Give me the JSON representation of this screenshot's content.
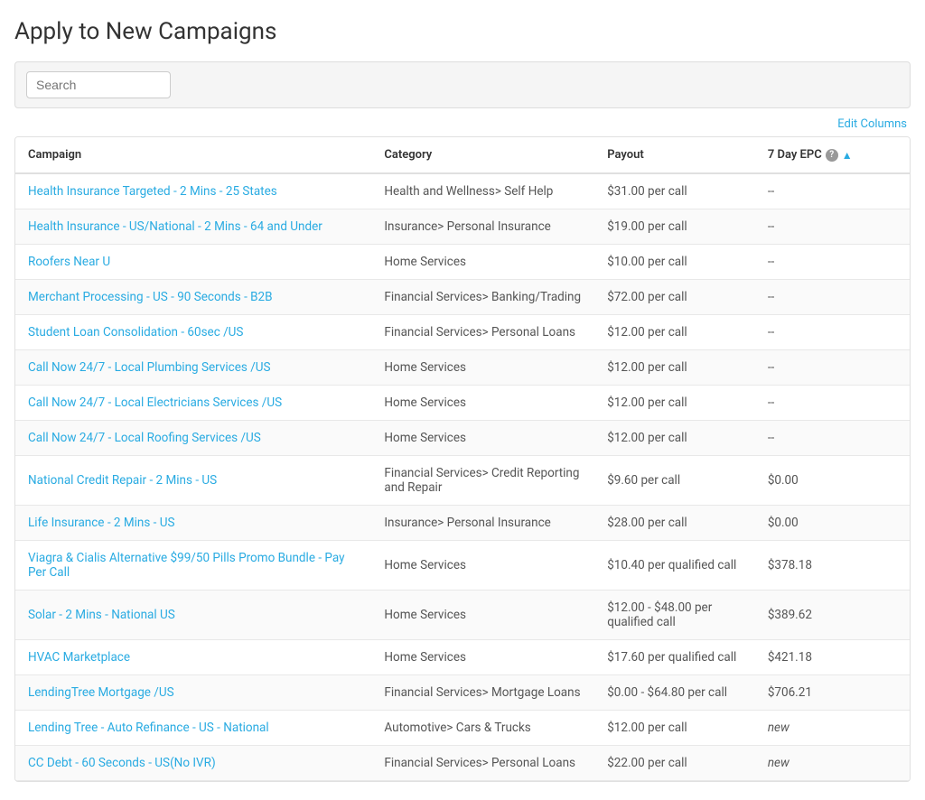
{
  "page": {
    "title": "Apply to New Campaigns"
  },
  "search": {
    "placeholder": "Search"
  },
  "edit_columns": {
    "label": "Edit Columns"
  },
  "table": {
    "headers": [
      {
        "id": "campaign",
        "label": "Campaign",
        "has_sort": false,
        "has_help": false
      },
      {
        "id": "category",
        "label": "Category",
        "has_sort": false,
        "has_help": false
      },
      {
        "id": "payout",
        "label": "Payout",
        "has_sort": false,
        "has_help": false
      },
      {
        "id": "7day",
        "label": "7 Day EPC",
        "has_sort": true,
        "has_help": true
      },
      {
        "id": "extra",
        "label": "",
        "has_sort": false,
        "has_help": false
      }
    ],
    "rows": [
      {
        "campaign": "Health Insurance Targeted - 2 Mins - 25 States",
        "category": "Health and Wellness> Self Help",
        "payout": "$31.00 per call",
        "seven_day": "--"
      },
      {
        "campaign": "Health Insurance - US/National - 2 Mins - 64 and Under",
        "category": "Insurance> Personal Insurance",
        "payout": "$19.00 per call",
        "seven_day": "--"
      },
      {
        "campaign": "Roofers Near U",
        "category": "Home Services",
        "payout": "$10.00 per call",
        "seven_day": "--"
      },
      {
        "campaign": "Merchant Processing - US - 90 Seconds - B2B",
        "category": "Financial Services> Banking/Trading",
        "payout": "$72.00 per call",
        "seven_day": "--"
      },
      {
        "campaign": "Student Loan Consolidation - 60sec /US",
        "category": "Financial Services> Personal Loans",
        "payout": "$12.00 per call",
        "seven_day": "--"
      },
      {
        "campaign": "Call Now 24/7 - Local Plumbing Services /US",
        "category": "Home Services",
        "payout": "$12.00 per call",
        "seven_day": "--"
      },
      {
        "campaign": "Call Now 24/7 - Local Electricians Services /US",
        "category": "Home Services",
        "payout": "$12.00 per call",
        "seven_day": "--"
      },
      {
        "campaign": "Call Now 24/7 - Local Roofing Services /US",
        "category": "Home Services",
        "payout": "$12.00 per call",
        "seven_day": "--"
      },
      {
        "campaign": "National Credit Repair - 2 Mins - US",
        "category": "Financial Services> Credit Reporting and Repair",
        "payout": "$9.60 per call",
        "seven_day": "$0.00"
      },
      {
        "campaign": "Life Insurance - 2 Mins - US",
        "category": "Insurance> Personal Insurance",
        "payout": "$28.00 per call",
        "seven_day": "$0.00"
      },
      {
        "campaign": "Viagra & Cialis Alternative $99/50 Pills Promo Bundle - Pay Per Call",
        "category": "Home Services",
        "payout": "$10.40 per qualified call",
        "seven_day": "$378.18"
      },
      {
        "campaign": "Solar - 2 Mins - National US",
        "category": "Home Services",
        "payout": "$12.00 - $48.00 per qualified call",
        "seven_day": "$389.62"
      },
      {
        "campaign": "HVAC Marketplace",
        "category": "Home Services",
        "payout": "$17.60 per qualified call",
        "seven_day": "$421.18"
      },
      {
        "campaign": "LendingTree Mortgage /US",
        "category": "Financial Services> Mortgage Loans",
        "payout": "$0.00 - $64.80 per call",
        "seven_day": "$706.21"
      },
      {
        "campaign": "Lending Tree - Auto Refinance - US - National",
        "category": "Automotive> Cars & Trucks",
        "payout": "$12.00 per call",
        "seven_day": "new",
        "seven_day_italic": true
      },
      {
        "campaign": "CC Debt - 60 Seconds - US(No IVR)",
        "category": "Financial Services> Personal Loans",
        "payout": "$22.00 per call",
        "seven_day": "new",
        "seven_day_italic": true
      }
    ]
  }
}
